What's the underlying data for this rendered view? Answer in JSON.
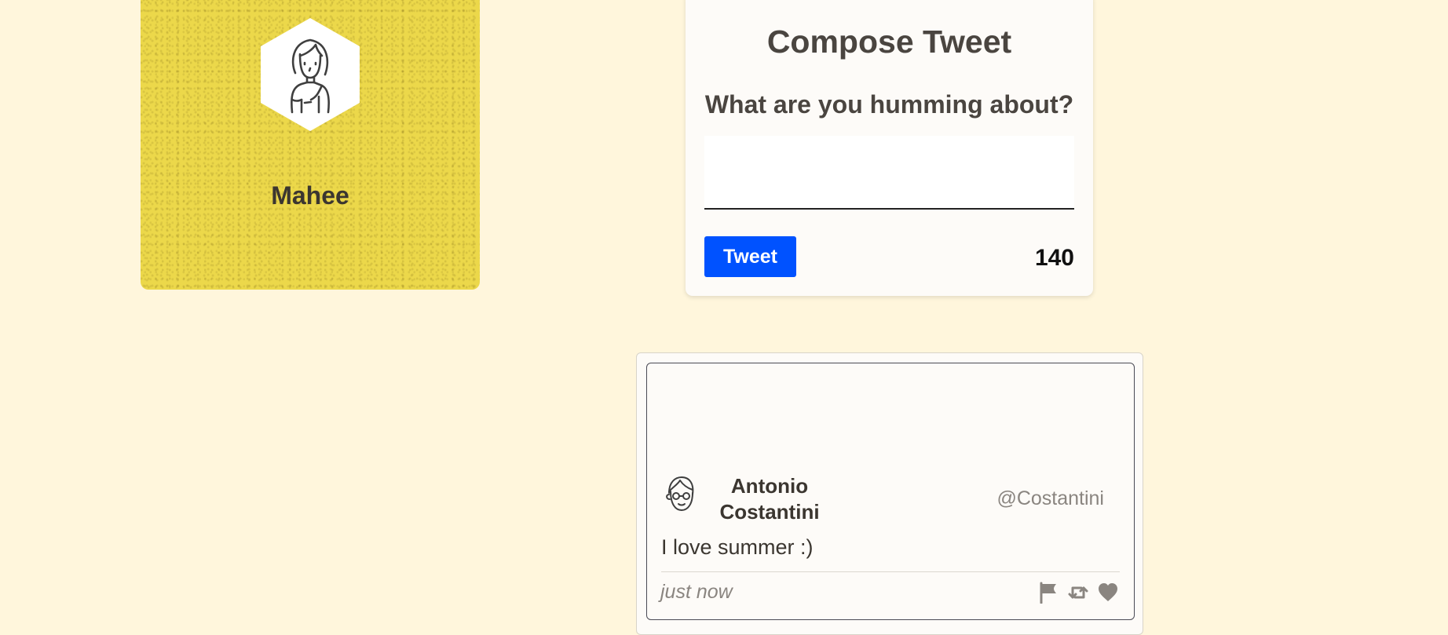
{
  "profile": {
    "name": "Mahee",
    "avatar_icon": "woman-avatar-icon",
    "background_color": "#ecd84a"
  },
  "compose": {
    "title": "Compose Tweet",
    "prompt": "What are you humming about?",
    "input_value": "",
    "button_label": "Tweet",
    "button_color": "#0052ff",
    "char_count": "140"
  },
  "tweet": {
    "author_name": "Antonio Costantini",
    "handle": "@Costantini",
    "text": "I love summer :)",
    "timestamp": "just now",
    "avatar_icon": "man-with-glasses-avatar-icon",
    "actions": [
      "flag-icon",
      "retweet-icon",
      "heart-icon"
    ]
  },
  "colors": {
    "page_background": "#fff6dc",
    "text_dark": "#4a4540",
    "text_muted": "#8a8580"
  }
}
